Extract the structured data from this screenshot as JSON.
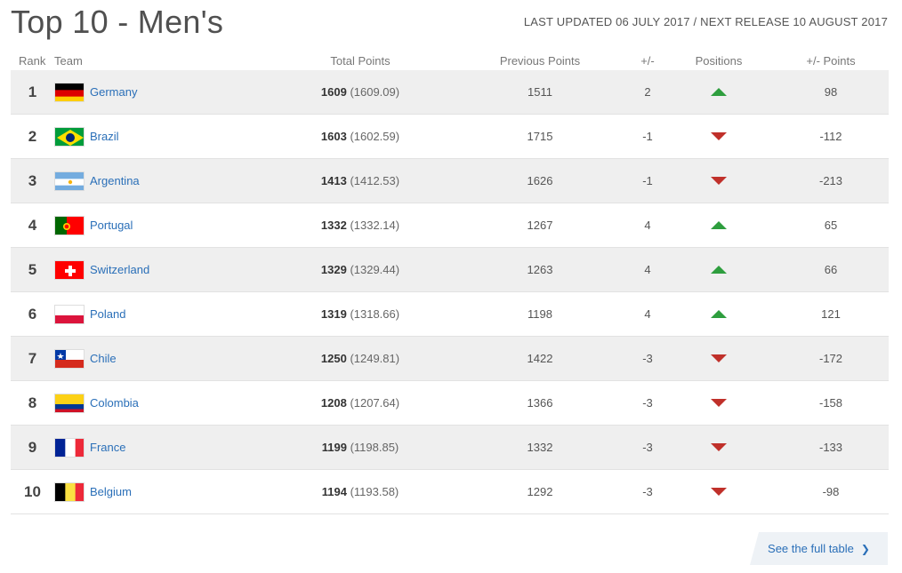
{
  "title": "Top 10 - Men's",
  "update_text": "LAST UPDATED 06 JULY 2017 / NEXT RELEASE 10 AUGUST 2017",
  "headers": {
    "rank": "Rank",
    "team": "Team",
    "total": "Total Points",
    "prev": "Previous Points",
    "diff": "+/-",
    "positions": "Positions",
    "pm_points": "+/- Points"
  },
  "rows": [
    {
      "rank": "1",
      "team": "Germany",
      "flag": "germany",
      "total": "1609",
      "total_exact": "(1609.09)",
      "prev": "1511",
      "diff": "2",
      "direction": "up",
      "pm": "98"
    },
    {
      "rank": "2",
      "team": "Brazil",
      "flag": "brazil",
      "total": "1603",
      "total_exact": "(1602.59)",
      "prev": "1715",
      "diff": "-1",
      "direction": "down",
      "pm": "-112"
    },
    {
      "rank": "3",
      "team": "Argentina",
      "flag": "argentina",
      "total": "1413",
      "total_exact": "(1412.53)",
      "prev": "1626",
      "diff": "-1",
      "direction": "down",
      "pm": "-213"
    },
    {
      "rank": "4",
      "team": "Portugal",
      "flag": "portugal",
      "total": "1332",
      "total_exact": "(1332.14)",
      "prev": "1267",
      "diff": "4",
      "direction": "up",
      "pm": "65"
    },
    {
      "rank": "5",
      "team": "Switzerland",
      "flag": "switzerland",
      "total": "1329",
      "total_exact": "(1329.44)",
      "prev": "1263",
      "diff": "4",
      "direction": "up",
      "pm": "66"
    },
    {
      "rank": "6",
      "team": "Poland",
      "flag": "poland",
      "total": "1319",
      "total_exact": "(1318.66)",
      "prev": "1198",
      "diff": "4",
      "direction": "up",
      "pm": "121"
    },
    {
      "rank": "7",
      "team": "Chile",
      "flag": "chile",
      "total": "1250",
      "total_exact": "(1249.81)",
      "prev": "1422",
      "diff": "-3",
      "direction": "down",
      "pm": "-172"
    },
    {
      "rank": "8",
      "team": "Colombia",
      "flag": "colombia",
      "total": "1208",
      "total_exact": "(1207.64)",
      "prev": "1366",
      "diff": "-3",
      "direction": "down",
      "pm": "-158"
    },
    {
      "rank": "9",
      "team": "France",
      "flag": "france",
      "total": "1199",
      "total_exact": "(1198.85)",
      "prev": "1332",
      "diff": "-3",
      "direction": "down",
      "pm": "-133"
    },
    {
      "rank": "10",
      "team": "Belgium",
      "flag": "belgium",
      "total": "1194",
      "total_exact": "(1193.58)",
      "prev": "1292",
      "diff": "-3",
      "direction": "down",
      "pm": "-98"
    }
  ],
  "full_table_label": "See the full table",
  "colors": {
    "up": "#2e9e3e",
    "down": "#c0302a",
    "link": "#2a6fb8",
    "row_alt": "#efefef"
  }
}
